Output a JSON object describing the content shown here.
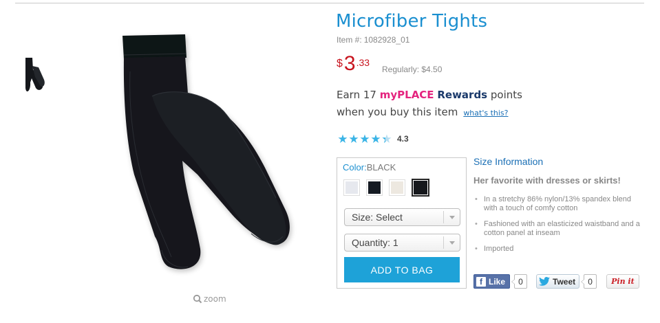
{
  "product": {
    "title": "Microfiber Tights",
    "item_label": "Item #:",
    "item_number": "1082928_01",
    "price_currency": "$",
    "price_dollars": "3",
    "price_cents": ".33",
    "regular_price": "Regularly: $4.50"
  },
  "rewards": {
    "earn_prefix": "Earn 17",
    "brand_my": "my",
    "brand_place": "PLACE",
    "brand_rewards": "Rewards",
    "earn_suffix": "points",
    "buy_line": "when you buy this item",
    "whats_this_link": "what's this?"
  },
  "rating": {
    "value": "4.3",
    "score": 4.3,
    "max": 5,
    "star_color": "#3ab4e6"
  },
  "options": {
    "color_label": "Color:",
    "color_value": "BLACK",
    "swatches": [
      {
        "name": "light gray",
        "color": "#e6e8ee",
        "selected": false
      },
      {
        "name": "dark navy",
        "color": "#151a22",
        "selected": false
      },
      {
        "name": "cream",
        "color": "#ede8e0",
        "selected": false
      },
      {
        "name": "black",
        "color": "#16181c",
        "selected": true
      }
    ],
    "size_select": "Size: Select",
    "quantity_select": "Quantity: 1",
    "add_to_bag": "ADD TO BAG"
  },
  "details": {
    "size_info_link": "Size Information",
    "tagline": "Her favorite with dresses or skirts!",
    "features": [
      "In a stretchy 86% nylon/13% spandex blend with a touch of comfy cotton",
      "Fashioned with an elasticized waistband and a cotton panel at inseam",
      "Imported"
    ]
  },
  "media": {
    "zoom_label": "zoom",
    "zoom_icon": "magnifier-icon",
    "thumbnail_icon": "tights-thumbnail",
    "main_image": "tights-product-image"
  },
  "social": {
    "facebook_label": "Like",
    "facebook_count": "0",
    "twitter_label": "Tweet",
    "twitter_count": "0",
    "pinterest_label": "Pin it"
  },
  "colors": {
    "accent_blue": "#1a8fd0",
    "price_red": "#c8141e",
    "button_blue": "#1ea2d8",
    "rewards_pink": "#e4237e"
  }
}
